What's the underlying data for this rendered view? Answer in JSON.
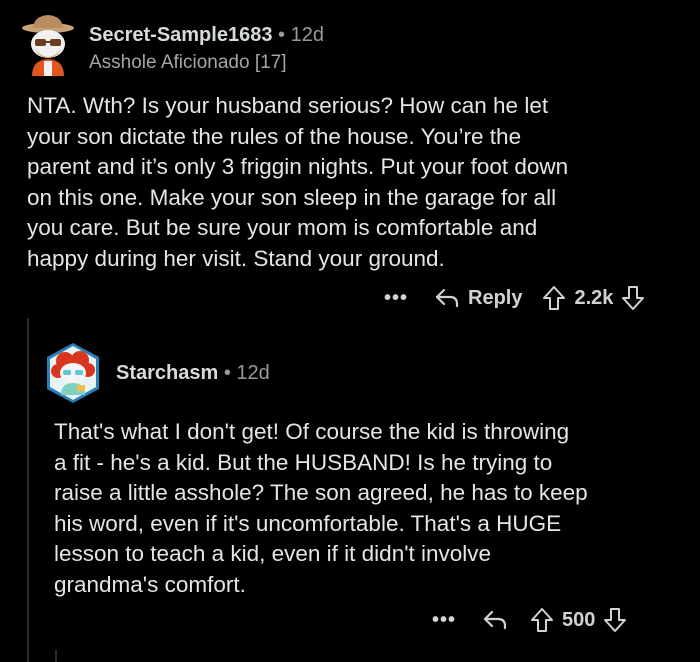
{
  "comment": {
    "username": "Secret-Sample1683",
    "separator": "•",
    "age": "12d",
    "flair": "Asshole Aficionado [17]",
    "body": "NTA.  Wth?  Is your husband serious?  How can he let\nyour son dictate the rules of the house.   You’re the\nparent and it’s only 3 friggin nights.  Put your foot down\non this one.   Make your son sleep in the garage for all\nyou care.  But be sure your mom is comfortable and\nhappy during her visit.  Stand your ground.",
    "more": "•••",
    "reply_label": "Reply",
    "score": "2.2k"
  },
  "reply": {
    "username": "Starchasm",
    "separator": "•",
    "age": "12d",
    "body": "That's what I don't get! Of course the kid is throwing\na fit - he's a kid. But the HUSBAND! Is he trying to\nraise a little asshole? The son agreed, he has to keep\nhis word, even if it's uncomfortable. That's a HUGE\nlesson to teach a kid, even if it didn't involve\ngrandma's comfort.",
    "more": "•••",
    "score": "500"
  },
  "icons": {
    "reply": "reply-arrow-icon",
    "upvote": "upvote-arrow-icon",
    "downvote": "downvote-arrow-icon"
  }
}
